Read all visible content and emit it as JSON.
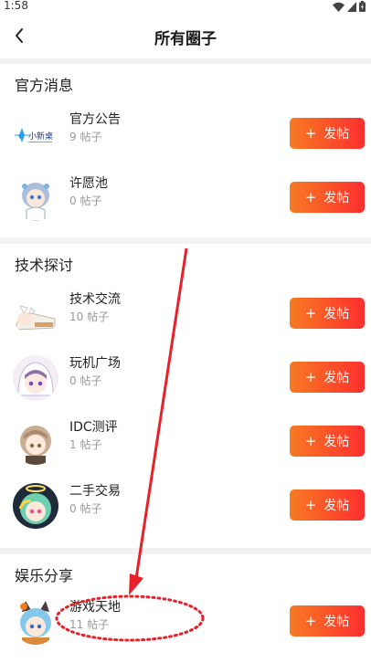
{
  "status_bar": {
    "time": "1:58"
  },
  "header": {
    "title": "所有圈子"
  },
  "sections": [
    {
      "title": "官方消息",
      "items": [
        {
          "name": "官方公告",
          "count": "9 帖子",
          "avatar": "xiaoxinzhuo-logo",
          "button": "发帖"
        },
        {
          "name": "许愿池",
          "count": "0 帖子",
          "avatar": "anime-girl-blue-hair",
          "button": "发帖"
        }
      ]
    },
    {
      "title": "技术探讨",
      "items": [
        {
          "name": "技术交流",
          "count": "10 帖子",
          "avatar": "anime-girl-lying",
          "button": "发帖"
        },
        {
          "name": "玩机广场",
          "count": "0 帖子",
          "avatar": "anime-girl-purple-hood",
          "button": "发帖"
        },
        {
          "name": "IDC测评",
          "count": "1 帖子",
          "avatar": "anime-girl-brown-hair",
          "button": "发帖"
        },
        {
          "name": "二手交易",
          "count": "0 帖子",
          "avatar": "anime-girl-halo",
          "button": "发帖"
        }
      ]
    },
    {
      "title": "娱乐分享",
      "items": [
        {
          "name": "游戏天地",
          "count": "11 帖子",
          "avatar": "anime-girl-cat-ears",
          "button": "发帖"
        }
      ]
    }
  ],
  "logo_text": "小新桌",
  "annotation": {
    "arrow_color": "#e8202a",
    "ellipse_color": "#e8202a"
  }
}
